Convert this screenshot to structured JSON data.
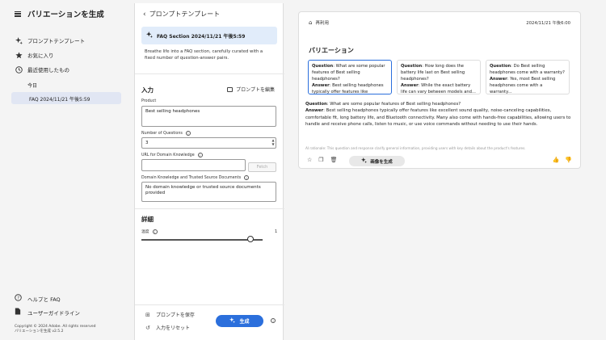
{
  "app": {
    "title": "バリエーションを生成"
  },
  "sidebar": {
    "items": [
      {
        "label": "プロンプトテンプレート",
        "icon": "sparkle-icon"
      },
      {
        "label": "お気に入り",
        "icon": "star-icon"
      },
      {
        "label": "最近使用したもの",
        "icon": "clock-icon"
      }
    ],
    "recent_group": "今日",
    "recent_active": "FAQ 2024/11/21 午後5:59",
    "footer": [
      {
        "label": "ヘルプと FAQ",
        "icon": "help-icon"
      },
      {
        "label": "ユーザーガイドライン",
        "icon": "document-icon"
      }
    ],
    "copyright_line1": "Copyright © 2024 Adobe. All rights reserved",
    "copyright_line2": "バリエーションを生成 v2.5.2"
  },
  "middle": {
    "back_label": "プロンプトテンプレート",
    "section_title": "FAQ Section 2024/11/21 午後5:59",
    "section_description": "Breathe life into a FAQ section, carefully curated with a fixed number of question-answer pairs.",
    "input_heading": "入力",
    "edit_prompt_label": "プロンプトを編集",
    "product_label": "Product",
    "product_value": "Best selling headphones",
    "num_questions_label": "Number of Questions",
    "num_questions_value": "3",
    "url_label": "URL for Domain Knowledge",
    "url_value": "",
    "fetch_label": "Fetch",
    "docs_label": "Domain Knowledge and Trusted Source Documents",
    "docs_value": "No domain knowledge or trusted source documents provided",
    "detail_heading": "詳細",
    "temperature_label": "温度",
    "temperature_max": "1",
    "temperature_value": 0.9,
    "save_prompt_label": "プロンプトを保存",
    "reset_label": "入力をリセット",
    "generate_label": "生成"
  },
  "result": {
    "reuse_label": "再利用",
    "timestamp": "2024/11/21 午後6:00",
    "variations_heading": "バリエーション",
    "variations": [
      {
        "q_label": "Question",
        "q": "What are some popular features of Best selling headphones?",
        "a_label": "Answer",
        "a": "Best selling headphones typically offer features like excellent...",
        "selected": true
      },
      {
        "q_label": "Question",
        "q": "How long does the battery life last on Best selling headphones?",
        "a_label": "Answer",
        "a": "While the exact battery life can vary between models and...",
        "selected": false
      },
      {
        "q_label": "Question",
        "q": "Do Best selling headphones come with a warranty?",
        "a_label": "Answer",
        "a": "Yes, most Best selling headphones come with a warranty...",
        "selected": false
      }
    ],
    "full_q_label": "Question",
    "full_q": "What are some popular features of Best selling headphones?",
    "full_a_label": "Answer",
    "full_a": "Best selling headphones typically offer features like excellent sound quality, noise-canceling capabilities, comfortable fit, long battery life, and Bluetooth connectivity. Many also come with hands-free capabilities, allowing users to handle and receive phone calls, listen to music, or use voice commands without needing to use their hands.",
    "ai_note": "AI rationale: This question and response clarify general information, providing users with key details about the product's features.",
    "generate_image_label": "画像を生成"
  },
  "colors": {
    "accent": "#2b6fdc",
    "selected_bg": "#e1e6f3",
    "card_bg": "#e1ecfa"
  }
}
